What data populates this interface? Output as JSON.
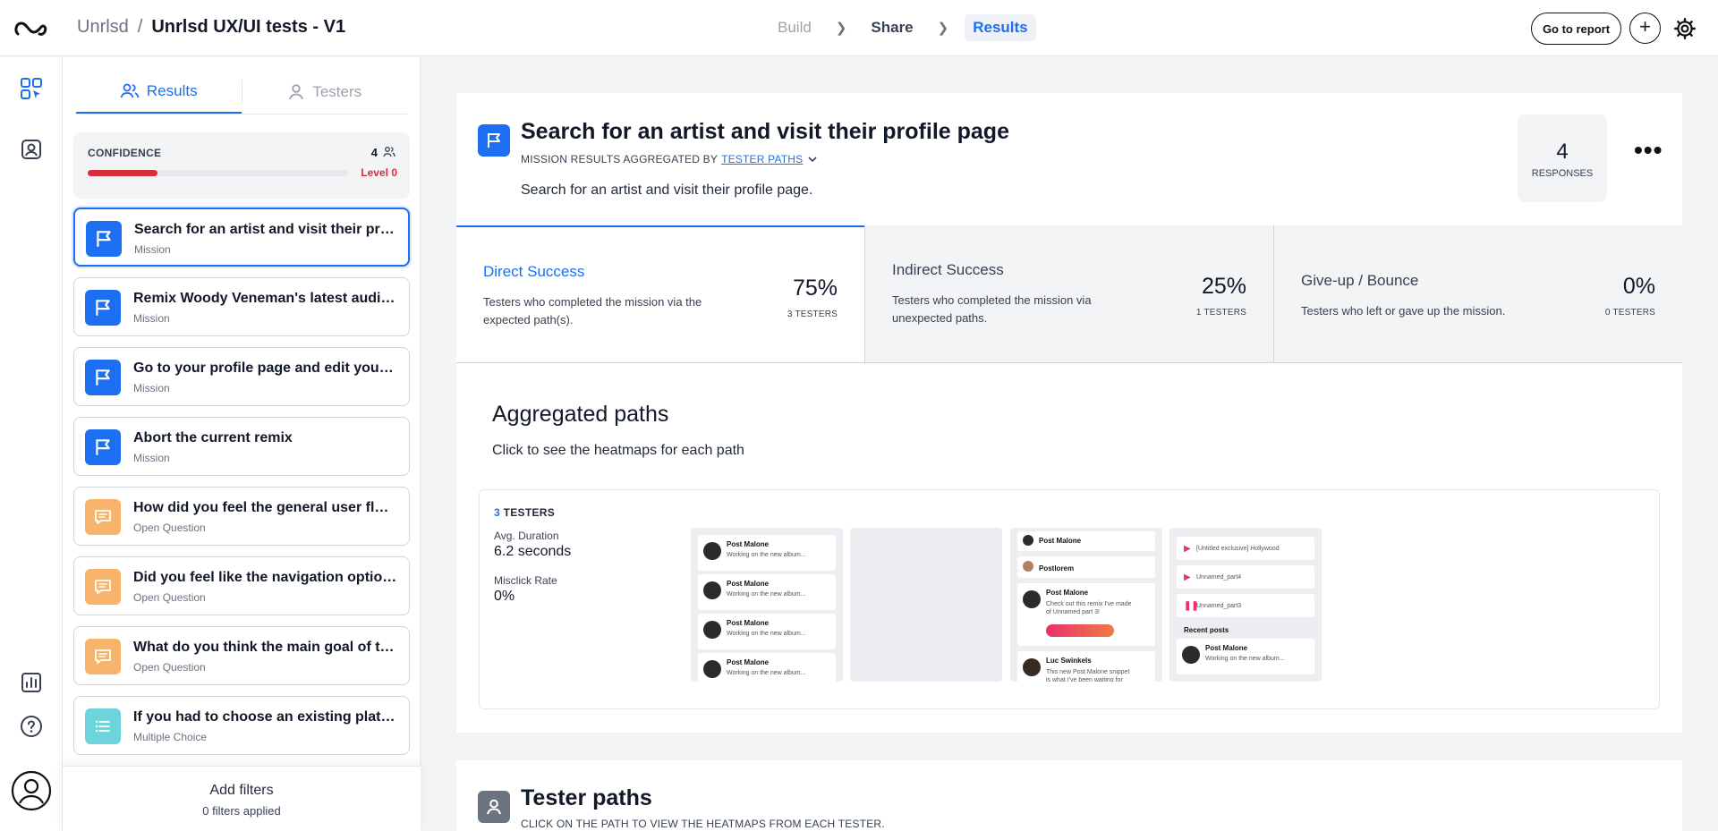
{
  "header": {
    "org": "Unrlsd",
    "separator": "/",
    "project": "Unrlsd UX/UI tests - V1",
    "steps": [
      "Build",
      "Share",
      "Results"
    ],
    "go_to_report": "Go to report",
    "add": "+"
  },
  "sidebar": {
    "tabs": [
      {
        "label": "Results",
        "active": true
      },
      {
        "label": "Testers",
        "active": false
      }
    ],
    "confidence": {
      "label": "CONFIDENCE",
      "count": "4",
      "level": "Level 0",
      "progress": 0.27
    },
    "items": [
      {
        "title": "Search for an artist and visit their profile page",
        "type": "Mission",
        "icon": "flag-icon",
        "selected": true
      },
      {
        "title": "Remix Woody Veneman's latest audio snippet",
        "type": "Mission",
        "icon": "flag-icon"
      },
      {
        "title": "Go to your profile page and edit your bio",
        "type": "Mission",
        "icon": "flag-icon"
      },
      {
        "title": "Abort the current remix",
        "type": "Mission",
        "icon": "flag-icon"
      },
      {
        "title": "How did you feel the general user flow was?",
        "type": "Open Question",
        "icon": "chat-icon"
      },
      {
        "title": "Did you feel like the navigation options were clear?",
        "type": "Open Question",
        "icon": "chat-icon"
      },
      {
        "title": "What do you think the main goal of the app is?",
        "type": "Open Question",
        "icon": "chat-icon"
      },
      {
        "title": "If you had to choose an existing platform, which one?",
        "type": "Multiple Choice",
        "icon": "list-icon"
      }
    ],
    "filters": {
      "title": "Add filters",
      "applied": "0 filters applied"
    }
  },
  "mission": {
    "title": "Search for an artist and visit their profile page",
    "aggregated_prefix": "MISSION RESULTS AGGREGATED BY",
    "aggregated_link": "TESTER PATHS",
    "description": "Search for an artist and visit their profile page.",
    "responses_count": "4",
    "responses_label": "RESPONSES",
    "more": "•••"
  },
  "stats": [
    {
      "title": "Direct Success",
      "desc": "Testers who completed the mission via the expected path(s).",
      "percent": "75%",
      "testers": "3 TESTERS"
    },
    {
      "title": "Indirect Success",
      "desc": "Testers who completed the mission via unexpected paths.",
      "percent": "25%",
      "testers": "1 TESTERS"
    },
    {
      "title": "Give-up / Bounce",
      "desc": "Testers who left or gave up the mission.",
      "percent": "0%",
      "testers": "0 TESTERS"
    }
  ],
  "aggregated": {
    "title": "Aggregated paths",
    "subtitle": "Click to see the heatmaps for each path",
    "path": {
      "tester_count": "3",
      "tester_label": "TESTERS",
      "duration_label": "Avg. Duration",
      "duration": "6.2 seconds",
      "misclick_label": "Misclick Rate",
      "misclick": "0%"
    },
    "thumbs": {
      "post_name": "Post Malone",
      "post_text": "Working on the new album...",
      "postlorem": "Postlorem",
      "remix_text": "Check out this remix I've made of Unnamed part 3!",
      "luc": "Luc Swinkels",
      "luc_text": "This new Post Malone snippet is what I've been waiting for",
      "snippet1": "[Untitled exclusive] Hollywood",
      "snippet2": "Unnamed_part4",
      "snippet3": "Unnamed_part3",
      "recent": "Recent posts"
    }
  },
  "tester_paths": {
    "title": "Tester paths",
    "subtitle": "CLICK ON THE PATH TO VIEW THE HEATMAPS FROM EACH TESTER."
  },
  "colors": {
    "accent": "#1d6ff2",
    "danger": "#d32f3a",
    "mission": "#1d6ff2",
    "open_question": "#f8b46a",
    "multiple_choice": "#6dd3dc"
  }
}
